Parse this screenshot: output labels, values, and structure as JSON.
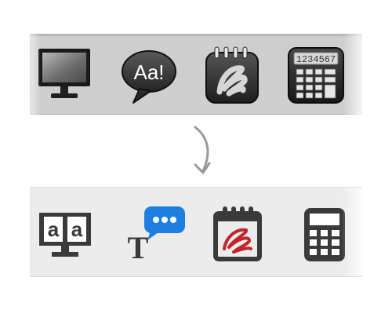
{
  "old_toolbar": {
    "items": [
      {
        "icon": "monitor-icon"
      },
      {
        "icon": "speech-bubble-icon",
        "text": "Aa!"
      },
      {
        "icon": "notepad-icon"
      },
      {
        "icon": "calculator-icon",
        "display": "1234567"
      }
    ]
  },
  "new_toolbar": {
    "items": [
      {
        "icon": "monitor-icon",
        "letters": [
          "a",
          "a"
        ]
      },
      {
        "icon": "text-chat-icon",
        "letter": "T",
        "bubble_color": "#1f7fe0"
      },
      {
        "icon": "notepad-icon",
        "scribble_color": "#c0262b"
      },
      {
        "icon": "calculator-icon"
      }
    ]
  },
  "colors": {
    "new_icon_fill": "#3a3a3a",
    "chat_bubble": "#1f7fe0",
    "scribble_red": "#c0262b"
  }
}
